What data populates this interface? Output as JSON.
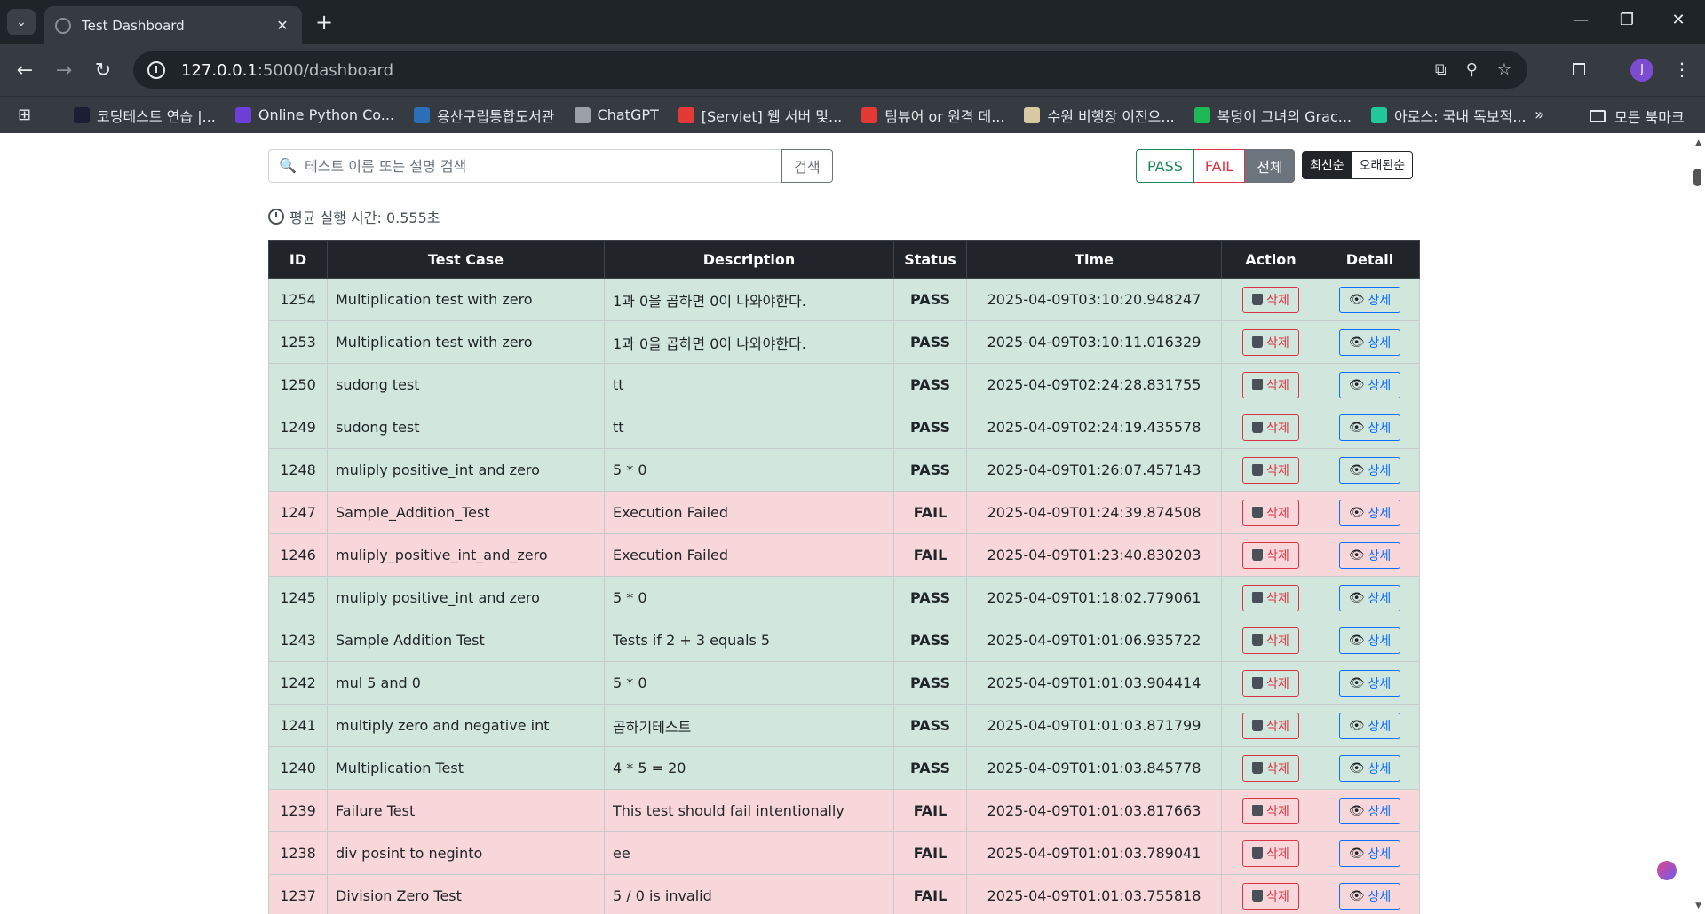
{
  "browser": {
    "tab_title": "Test Dashboard",
    "url_host": "127.0.0.1",
    "url_path": ":5000/dashboard",
    "avatar_letter": "J",
    "bookmarks": [
      {
        "label": "코딩테스트 연습 |...",
        "color": "#1a1f36"
      },
      {
        "label": "Online Python Co...",
        "color": "#6d3fd6"
      },
      {
        "label": "용산구립통합도서관",
        "color": "#2b6fb8"
      },
      {
        "label": "ChatGPT",
        "color": "#9aa0a6"
      },
      {
        "label": "[Servlet] 웹 서버 및...",
        "color": "#e53935"
      },
      {
        "label": "팀뷰어 or 원격 데...",
        "color": "#e53935"
      },
      {
        "label": "수원 비행장 이전으...",
        "color": "#d9c9a3"
      },
      {
        "label": "복덩이 그녀의 Grac...",
        "color": "#1db954"
      },
      {
        "label": "아로스: 국내 독보적...",
        "color": "#20c997"
      }
    ],
    "bookmarks_folder": "모든 북마크"
  },
  "search": {
    "placeholder": "테스트 이름 또는 설명 검색",
    "button": "검색"
  },
  "filters": {
    "pass": "PASS",
    "fail": "FAIL",
    "all": "전체"
  },
  "sort": {
    "newest": "최신순",
    "oldest": "오래된순"
  },
  "avg_label": "평균 실행 시간: 0.555초",
  "table": {
    "headers": [
      "ID",
      "Test Case",
      "Description",
      "Status",
      "Time",
      "Action",
      "Detail"
    ],
    "delete_label": "삭제",
    "detail_label": "상세",
    "rows": [
      {
        "id": "1254",
        "name": "Multiplication test with zero",
        "desc": "1과 0을 곱하면 0이 나와야한다.",
        "status": "PASS",
        "time": "2025-04-09T03:10:20.948247"
      },
      {
        "id": "1253",
        "name": "Multiplication test with zero",
        "desc": "1과 0을 곱하면 0이 나와야한다.",
        "status": "PASS",
        "time": "2025-04-09T03:10:11.016329"
      },
      {
        "id": "1250",
        "name": "sudong test",
        "desc": "tt",
        "status": "PASS",
        "time": "2025-04-09T02:24:28.831755"
      },
      {
        "id": "1249",
        "name": "sudong test",
        "desc": "tt",
        "status": "PASS",
        "time": "2025-04-09T02:24:19.435578"
      },
      {
        "id": "1248",
        "name": "muliply positive_int and zero",
        "desc": "5 * 0",
        "status": "PASS",
        "time": "2025-04-09T01:26:07.457143"
      },
      {
        "id": "1247",
        "name": "Sample_Addition_Test",
        "desc": "Execution Failed",
        "status": "FAIL",
        "time": "2025-04-09T01:24:39.874508"
      },
      {
        "id": "1246",
        "name": "muliply_positive_int_and_zero",
        "desc": "Execution Failed",
        "status": "FAIL",
        "time": "2025-04-09T01:23:40.830203"
      },
      {
        "id": "1245",
        "name": "muliply positive_int and zero",
        "desc": "5 * 0",
        "status": "PASS",
        "time": "2025-04-09T01:18:02.779061"
      },
      {
        "id": "1243",
        "name": "Sample Addition Test",
        "desc": "Tests if 2 + 3 equals 5",
        "status": "PASS",
        "time": "2025-04-09T01:01:06.935722"
      },
      {
        "id": "1242",
        "name": "mul 5 and 0",
        "desc": "5 * 0",
        "status": "PASS",
        "time": "2025-04-09T01:01:03.904414"
      },
      {
        "id": "1241",
        "name": "multiply zero and negative int",
        "desc": "곱하기테스트",
        "status": "PASS",
        "time": "2025-04-09T01:01:03.871799"
      },
      {
        "id": "1240",
        "name": "Multiplication Test",
        "desc": "4 * 5 = 20",
        "status": "PASS",
        "time": "2025-04-09T01:01:03.845778"
      },
      {
        "id": "1239",
        "name": "Failure Test",
        "desc": "This test should fail intentionally",
        "status": "FAIL",
        "time": "2025-04-09T01:01:03.817663"
      },
      {
        "id": "1238",
        "name": "div posint to neginto",
        "desc": "ee",
        "status": "FAIL",
        "time": "2025-04-09T01:01:03.789041"
      },
      {
        "id": "1237",
        "name": "Division Zero Test",
        "desc": "5 / 0 is invalid",
        "status": "FAIL",
        "time": "2025-04-09T01:01:03.755818"
      }
    ]
  }
}
